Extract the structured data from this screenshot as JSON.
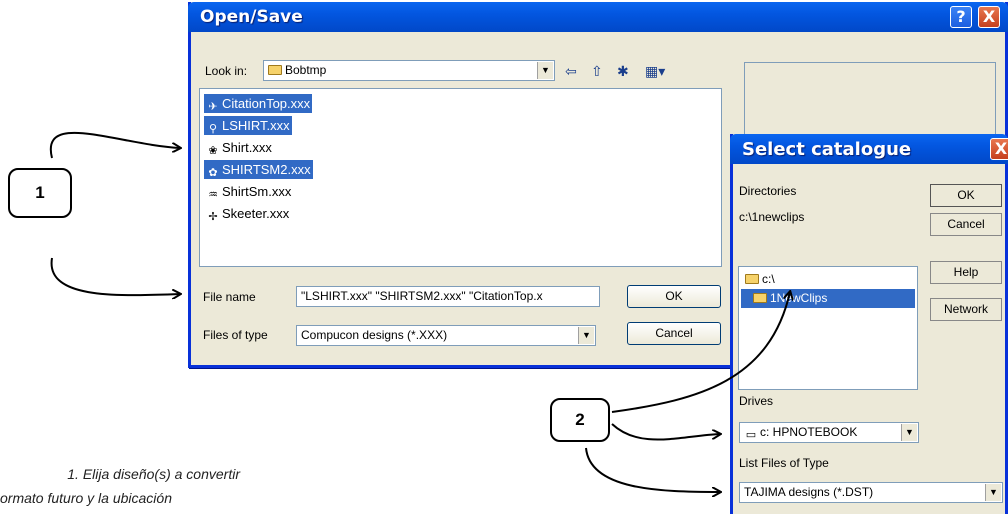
{
  "open_dialog": {
    "title": "Open/Save",
    "look_in_label": "Look in:",
    "look_in_value": "Bobtmp",
    "files": [
      {
        "name": "CitationTop.xxx",
        "selected": true,
        "icon": "plane-design-icon"
      },
      {
        "name": "LSHIRT.xxx",
        "selected": true,
        "icon": "shirt-design-icon"
      },
      {
        "name": "Shirt.xxx",
        "selected": false,
        "icon": "shirt-design-icon"
      },
      {
        "name": "SHIRTSM2.xxx",
        "selected": true,
        "icon": "shirt-design-icon"
      },
      {
        "name": "ShirtSm.xxx",
        "selected": false,
        "icon": "shirt-design-icon"
      },
      {
        "name": "Skeeter.xxx",
        "selected": false,
        "icon": "skeeter-design-icon"
      }
    ],
    "file_name_label": "File name",
    "file_name_value": "\"LSHIRT.xxx\" \"SHIRTSM2.xxx\" \"CitationTop.x",
    "files_of_type_label": "Files of type",
    "files_of_type_value": "Compucon designs (*.XXX)",
    "ok_label": "OK",
    "cancel_label": "Cancel",
    "help_btn": "?",
    "close_btn": "X"
  },
  "catalogue_dialog": {
    "title": "Select catalogue",
    "directories_label": "Directories",
    "current_path": "c:\\1newclips",
    "dirs": [
      {
        "name": "c:\\",
        "selected": false
      },
      {
        "name": "1NewClips",
        "selected": true
      }
    ],
    "ok_label": "OK",
    "cancel_label": "Cancel",
    "help_label": "Help",
    "network_label": "Network",
    "drives_label": "Drives",
    "drive_value": "c: HPNOTEBOOK",
    "list_type_label": "List Files of Type",
    "list_type_value": "TAJIMA designs (*.DST)",
    "close_btn": "X"
  },
  "annotations": {
    "callout_1": "1",
    "callout_2": "2",
    "caption_line1": "1. Elija diseño(s) a convertir",
    "caption_line2": "ormato futuro y la ubicación"
  }
}
